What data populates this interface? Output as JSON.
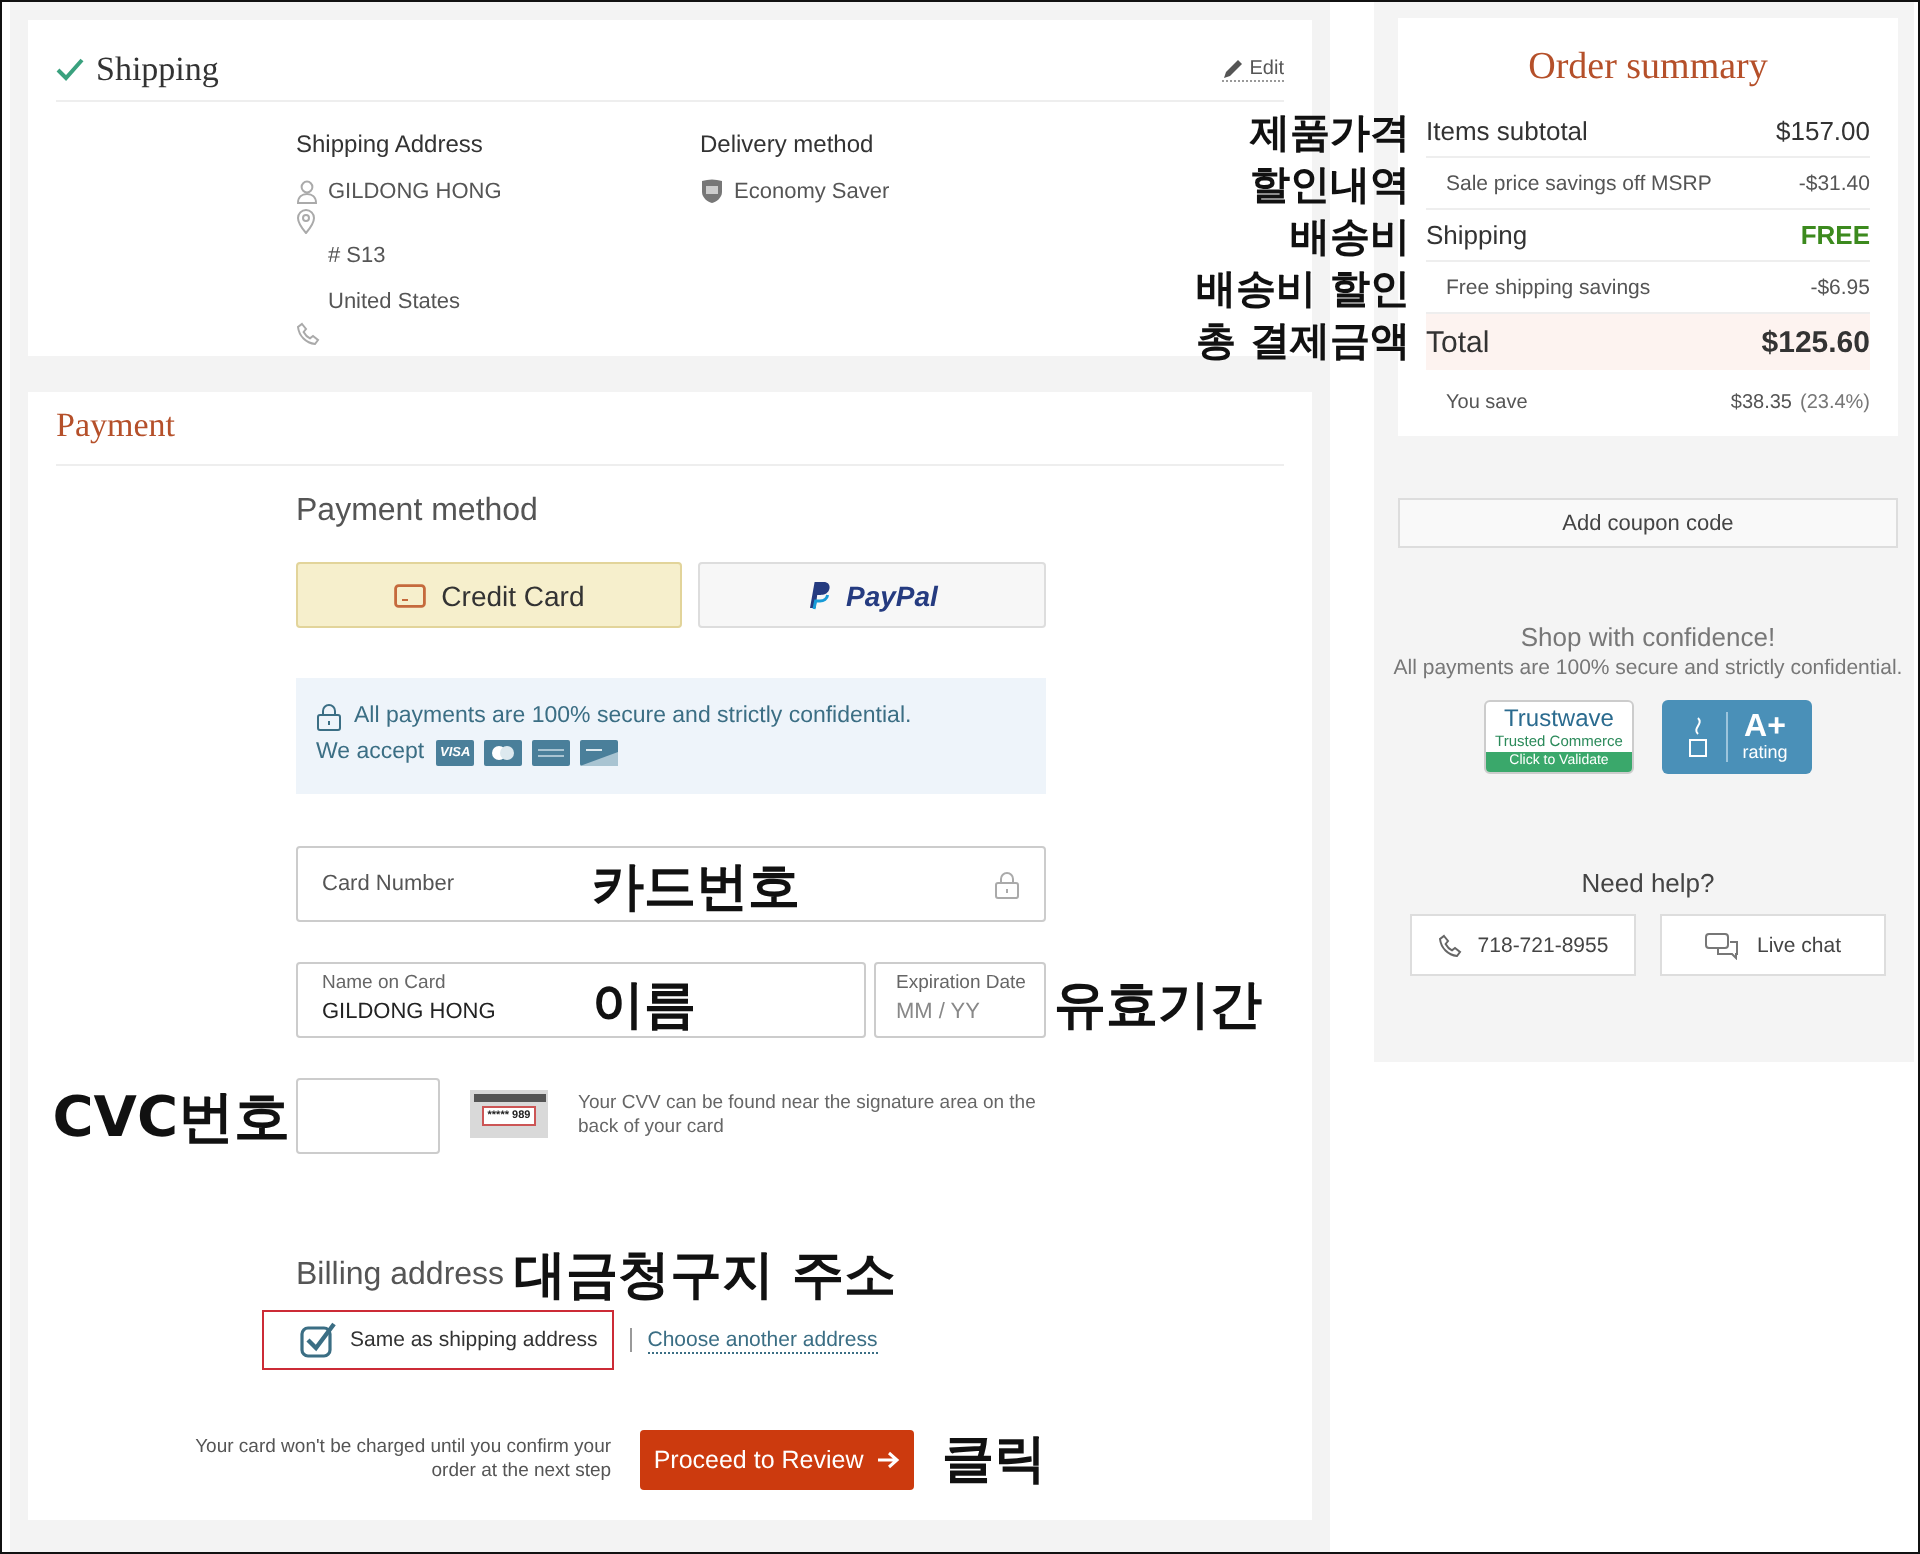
{
  "shipping": {
    "title": "Shipping",
    "completed": true,
    "edit_link": "Edit",
    "address": {
      "heading": "Shipping Address",
      "name": "GILDONG HONG",
      "line": "# S13",
      "country": "United States"
    },
    "delivery": {
      "heading": "Delivery method",
      "method": "Economy Saver"
    }
  },
  "payment": {
    "title": "Payment",
    "method_heading": "Payment method",
    "methods": [
      {
        "kind": "card",
        "label": "Credit Card",
        "selected": true
      },
      {
        "kind": "paypal",
        "label": "PayPal",
        "selected": false
      }
    ],
    "security": {
      "message": "All payments are 100% secure and strictly confidential.",
      "accept_label": "We accept",
      "cards": [
        {
          "kind": "visa",
          "label": "VISA"
        },
        {
          "kind": "mastercard"
        },
        {
          "kind": "amex"
        },
        {
          "kind": "discover"
        }
      ]
    },
    "card_number": {
      "placeholder": "Card Number",
      "annotation": "카드번호"
    },
    "name_on_card": {
      "label": "Name on Card",
      "value": "GILDONG HONG",
      "annotation": "이름"
    },
    "expiration": {
      "label": "Expiration Date",
      "placeholder": "MM / YY",
      "annotation": "유효기간"
    },
    "cvc": {
      "annotation": "CVC번호",
      "hint": "Your CVV can be found near the signature area on the back of your card",
      "sample": "***** 989"
    },
    "billing": {
      "heading": "Billing address",
      "annotation": "대금청구지 주소",
      "same_as_shipping": {
        "label": "Same as shipping address",
        "checked": true,
        "highlighted": true
      },
      "other_link": "Choose another address"
    },
    "charge_note": "Your card won't be charged until you confirm your order at the next step",
    "proceed_button": "Proceed to Review",
    "proceed_annotation": "클릭"
  },
  "order_summary": {
    "title": "Order summary",
    "rows": [
      {
        "kind": "main",
        "label": "Items subtotal",
        "value": "$157.00",
        "annotation": "제품가격"
      },
      {
        "kind": "sub",
        "label": "Sale price savings off MSRP",
        "value": "-$31.40",
        "annotation": "할인내역"
      },
      {
        "kind": "main",
        "label": "Shipping",
        "value": "FREE",
        "free": true,
        "annotation": "배송비"
      },
      {
        "kind": "sub",
        "label": "Free shipping savings",
        "value": "-$6.95",
        "annotation": "배송비 할인"
      },
      {
        "kind": "total",
        "label": "Total",
        "value": "$125.60",
        "annotation": "총 결제금액"
      },
      {
        "kind": "note",
        "label": "You save",
        "value": "$38.35",
        "extra": "(23.4%)"
      }
    ]
  },
  "coupon_button": "Add coupon code",
  "confidence": {
    "title": "Shop with confidence!",
    "text": "All payments are 100% secure and strictly confidential.",
    "badges": [
      {
        "kind": "trustwave",
        "name": "Trustwave",
        "line": "Trusted Commerce",
        "action": "Click to Validate"
      },
      {
        "kind": "bbb",
        "grade": "A+",
        "line": "rating"
      }
    ]
  },
  "help": {
    "title": "Need help?",
    "buttons": [
      {
        "kind": "phone",
        "label": "718-721-8955"
      },
      {
        "kind": "chat",
        "label": "Live chat"
      }
    ]
  }
}
